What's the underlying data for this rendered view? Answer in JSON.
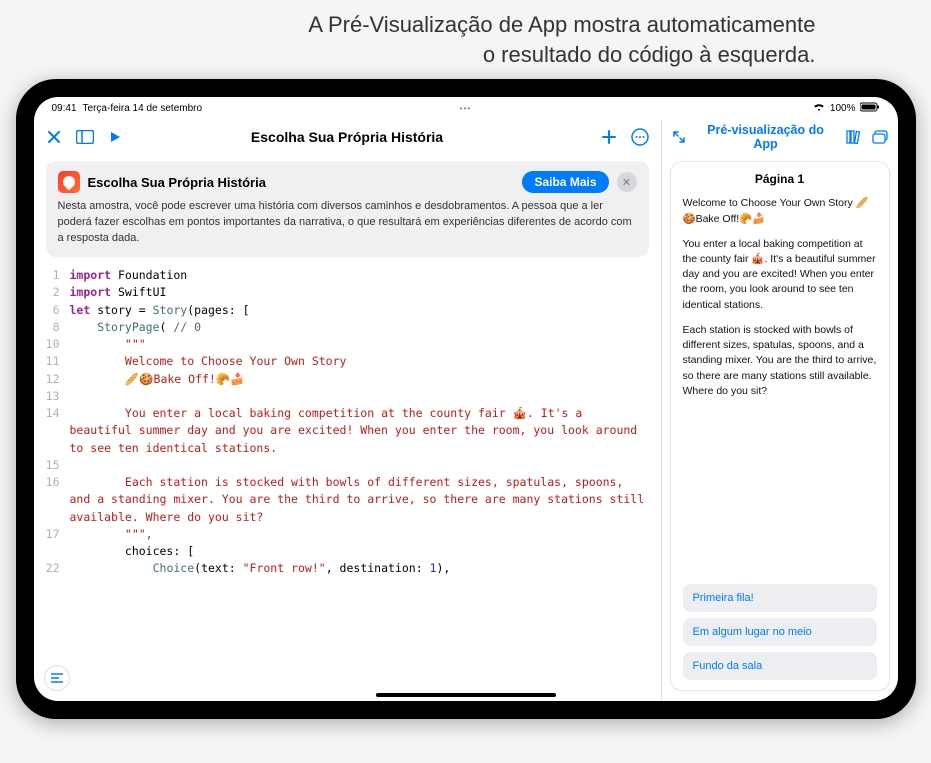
{
  "annotation": {
    "line1": "A Pré-Visualização de App mostra automaticamente",
    "line2": "o resultado do código à esquerda."
  },
  "status": {
    "time": "09:41",
    "date": "Terça-feira 14 de setembro",
    "battery": "100%"
  },
  "toolbar": {
    "title": "Escolha Sua Própria História"
  },
  "infoCard": {
    "title": "Escolha Sua Própria História",
    "buttonLabel": "Saiba Mais",
    "description": "Nesta amostra, você pode escrever uma história com diversos caminhos e desdobramentos. A pessoa que a ler poderá fazer escolhas em pontos importantes da narrativa, o que resultará em experiências diferentes de acordo com a resposta dada."
  },
  "code": {
    "l1a": "import",
    "l1b": " Foundation",
    "l2a": "import",
    "l2b": " SwiftUI",
    "l6a": "let",
    "l6b": " story = ",
    "l6c": "Story",
    "l6d": "(pages: [",
    "l8a": "    ",
    "l8b": "StoryPage",
    "l8c": "( ",
    "l8d": "// 0",
    "l10": "        \"\"\"",
    "l11": "        Welcome to Choose Your Own Story",
    "l12": "        🥖🍪Bake Off!🥐🍰",
    "l13": "",
    "l14": "        You enter a local baking competition at the county fair 🎪. It's a beautiful summer day and you are excited! When you enter the room, you look around to see ten identical stations.",
    "l15": "",
    "l16": "        Each station is stocked with bowls of different sizes, spatulas, spoons, and a standing mixer. You are the third to arrive, so there are many stations still available. Where do you sit?",
    "l17": "        \"\"\",",
    "l18": "        choices: [",
    "l22a": "            ",
    "l22b": "Choice",
    "l22c": "(text: ",
    "l22d": "\"Front row!\"",
    "l22e": ", destination: ",
    "l22f": "1",
    "l22g": "),"
  },
  "lineNumbers": {
    "n1": "1",
    "n2": "2",
    "n6": "6",
    "n8": "8",
    "n10": "10",
    "n11": "11",
    "n12": "12",
    "n13": "13",
    "n14": "14",
    "n15": "15",
    "n16": "16",
    "n17": "17",
    "n22": "22"
  },
  "rightToolbar": {
    "title": "Pré-visualização do App"
  },
  "preview": {
    "pageTitle": "Página 1",
    "p1": "Welcome to Choose Your Own Story 🥖🍪Bake Off!🥐🍰",
    "p2": "You enter a local baking competition at the county fair 🎪. It's a beautiful summer day and you are excited! When you enter the room, you look around to see ten identical stations.",
    "p3": "Each station is stocked with bowls of different sizes, spatulas, spoons, and a standing mixer. You are the third to arrive, so there are many stations still available. Where do you sit?",
    "choices": {
      "c1": "Primeira fila!",
      "c2": "Em algum lugar no meio",
      "c3": "Fundo da sala"
    }
  }
}
